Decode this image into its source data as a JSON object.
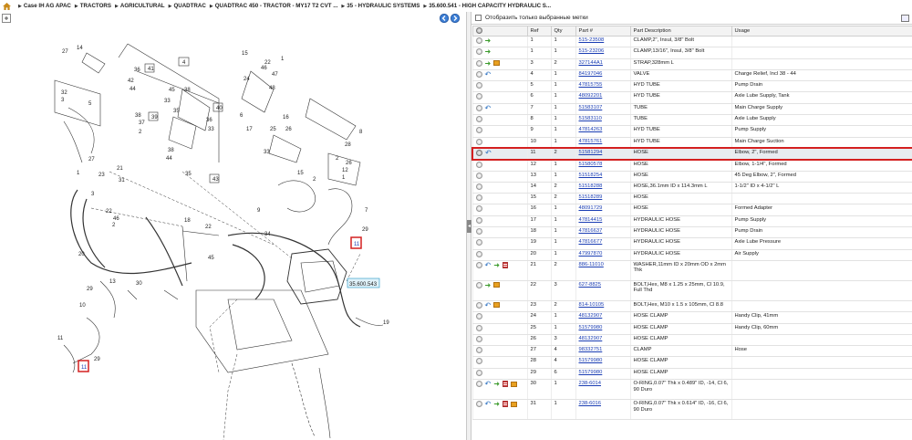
{
  "breadcrumb": [
    "Case IH AG APAC",
    "TRACTORS",
    "AGRICULTURAL",
    "QUADTRAC",
    "QUADTRAC 450 - TRACTOR - MY17 T2 CVT ...",
    "35 - HYDRAULIC SYSTEMS",
    "35.600.541 - HIGH CAPACITY HYDRAULIC S..."
  ],
  "filter": {
    "label": "Отобразить только выбранные метки"
  },
  "diagram": {
    "callout_label": "35.600.543",
    "labels": [
      "1",
      "2",
      "3",
      "4",
      "5",
      "6",
      "7",
      "8",
      "9",
      "10",
      "11",
      "12",
      "13",
      "14",
      "15",
      "16",
      "17",
      "18",
      "19",
      "20",
      "21",
      "22",
      "23",
      "24",
      "25",
      "26",
      "27",
      "28",
      "29",
      "30",
      "31",
      "32",
      "33",
      "34",
      "35",
      "36",
      "37",
      "38",
      "39",
      "40",
      "41",
      "42",
      "43",
      "44",
      "45",
      "46",
      "47",
      "48"
    ]
  },
  "table": {
    "headers": [
      "",
      "Ref",
      "Qty",
      "Part #",
      "Part Description",
      "Usage"
    ],
    "rows": [
      {
        "icons": [
          "circ",
          "arrow"
        ],
        "ref": "1",
        "qty": "1",
        "part": "515-23508",
        "desc": "CLAMP,2\", Insul, 3/8\" Bolt",
        "usage": ""
      },
      {
        "icons": [
          "circ",
          "arrow"
        ],
        "ref": "1",
        "qty": "1",
        "part": "515-23206",
        "desc": "CLAMP,13/16\", Insul, 3/8\" Bolt",
        "usage": ""
      },
      {
        "icons": [
          "circ",
          "arrow",
          "box"
        ],
        "ref": "3",
        "qty": "2",
        "part": "327144A1",
        "desc": "STRAP,328mm L",
        "usage": ""
      },
      {
        "icons": [
          "circ",
          "back"
        ],
        "ref": "4",
        "qty": "1",
        "part": "84197046",
        "desc": "VALVE",
        "usage": "Charge Relief, Incl 38 - 44"
      },
      {
        "icons": [
          "circ"
        ],
        "ref": "5",
        "qty": "1",
        "part": "47815755",
        "desc": "HYD TUBE",
        "usage": "Pump Drain"
      },
      {
        "icons": [
          "circ"
        ],
        "ref": "6",
        "qty": "1",
        "part": "48092201",
        "desc": "HYD TUBE",
        "usage": "Axle Lube Supply, Tank"
      },
      {
        "icons": [
          "circ",
          "back"
        ],
        "ref": "7",
        "qty": "1",
        "part": "51583107",
        "desc": "TUBE",
        "usage": "Main Charge Supply"
      },
      {
        "icons": [
          "circ"
        ],
        "ref": "8",
        "qty": "1",
        "part": "51583110",
        "desc": "TUBE",
        "usage": "Axle Lube Supply"
      },
      {
        "icons": [
          "circ"
        ],
        "ref": "9",
        "qty": "1",
        "part": "47814263",
        "desc": "HYD TUBE",
        "usage": "Pump Supply"
      },
      {
        "icons": [
          "circ"
        ],
        "ref": "10",
        "qty": "1",
        "part": "47815761",
        "desc": "HYD TUBE",
        "usage": "Main Charge Suction"
      },
      {
        "icons": [
          "circ-g",
          "back"
        ],
        "ref": "11",
        "qty": "2",
        "part": "51581294",
        "desc": "HOSE",
        "usage": "Elbow, 2\", Formed",
        "selected": true
      },
      {
        "icons": [
          "circ"
        ],
        "ref": "12",
        "qty": "1",
        "part": "51580578",
        "desc": "HOSE",
        "usage": "Elbow, 1-1/4\", Formed"
      },
      {
        "icons": [
          "circ"
        ],
        "ref": "13",
        "qty": "1",
        "part": "51518254",
        "desc": "HOSE",
        "usage": "45 Deg Elbow, 2\", Formed"
      },
      {
        "icons": [
          "circ"
        ],
        "ref": "14",
        "qty": "2",
        "part": "51518288",
        "desc": "HOSE,36.1mm ID x 114.3mm L",
        "usage": "1-1/2\" ID x 4-1/2\" L"
      },
      {
        "icons": [
          "circ"
        ],
        "ref": "15",
        "qty": "2",
        "part": "51518289",
        "desc": "HOSE",
        "usage": ""
      },
      {
        "icons": [
          "circ"
        ],
        "ref": "16",
        "qty": "1",
        "part": "48091729",
        "desc": "HOSE",
        "usage": "Formed Adapter"
      },
      {
        "icons": [
          "circ"
        ],
        "ref": "17",
        "qty": "1",
        "part": "47814415",
        "desc": "HYDRAULIC HOSE",
        "usage": "Pump Supply"
      },
      {
        "icons": [
          "circ"
        ],
        "ref": "18",
        "qty": "1",
        "part": "47816637",
        "desc": "HYDRAULIC HOSE",
        "usage": "Pump Drain"
      },
      {
        "icons": [
          "circ"
        ],
        "ref": "19",
        "qty": "1",
        "part": "47816677",
        "desc": "HYDRAULIC HOSE",
        "usage": "Axle Lube Pressure"
      },
      {
        "icons": [
          "circ"
        ],
        "ref": "20",
        "qty": "1",
        "part": "47997870",
        "desc": "HYDRAULIC HOSE",
        "usage": "Air Supply"
      },
      {
        "icons": [
          "circ",
          "back",
          "arrow",
          "doc"
        ],
        "ref": "21",
        "qty": "2",
        "part": "886-11010",
        "desc": "WASHER,11mm ID x 20mm OD x 2mm Thk",
        "usage": "",
        "tall": true
      },
      {
        "icons": [
          "circ",
          "arrow",
          "box"
        ],
        "ref": "22",
        "qty": "3",
        "part": "627-8825",
        "desc": "BOLT,Hex, M8 x 1.25 x 25mm, Cl 10.9, Full Thd",
        "usage": "",
        "tall": true
      },
      {
        "icons": [
          "circ",
          "back",
          "box"
        ],
        "ref": "23",
        "qty": "2",
        "part": "814-10105",
        "desc": "BOLT,Hex, M10 x 1.5 x 105mm, Cl 8.8",
        "usage": ""
      },
      {
        "icons": [
          "circ"
        ],
        "ref": "24",
        "qty": "1",
        "part": "48132907",
        "desc": "HOSE CLAMP",
        "usage": "Handy Clip, 41mm"
      },
      {
        "icons": [
          "circ"
        ],
        "ref": "25",
        "qty": "1",
        "part": "51579980",
        "desc": "HOSE CLAMP",
        "usage": "Handy Clip, 60mm"
      },
      {
        "icons": [
          "circ"
        ],
        "ref": "26",
        "qty": "3",
        "part": "48132907",
        "desc": "HOSE CLAMP",
        "usage": ""
      },
      {
        "icons": [
          "circ"
        ],
        "ref": "27",
        "qty": "4",
        "part": "98332751",
        "desc": "CLAMP",
        "usage": "Hose"
      },
      {
        "icons": [
          "circ"
        ],
        "ref": "28",
        "qty": "4",
        "part": "51579980",
        "desc": "HOSE CLAMP",
        "usage": ""
      },
      {
        "icons": [
          "circ"
        ],
        "ref": "29",
        "qty": "6",
        "part": "51579980",
        "desc": "HOSE CLAMP",
        "usage": ""
      },
      {
        "icons": [
          "circ",
          "back",
          "arrow",
          "doc",
          "box"
        ],
        "ref": "30",
        "qty": "1",
        "part": "238-6014",
        "desc": "O-RING,0.07\" Thk x 0.489\" ID, -14, Cl 6, 90 Duro",
        "usage": "",
        "tall": true
      },
      {
        "icons": [
          "circ",
          "back",
          "arrow",
          "doc",
          "box"
        ],
        "ref": "31",
        "qty": "1",
        "part": "238-6016",
        "desc": "O-RING,0.07\" Thk x 0.614\" ID, -16, Cl 6, 90 Duro",
        "usage": "",
        "tall": true
      }
    ]
  }
}
